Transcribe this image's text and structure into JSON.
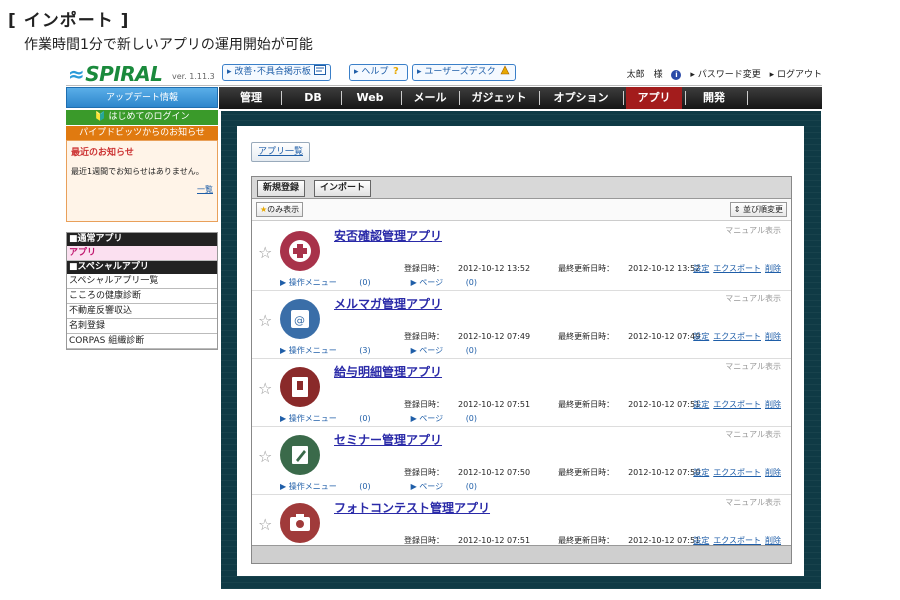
{
  "caption": {
    "title": "[ インポート ]",
    "subtitle": "作業時間1分で新しいアプリの運用開始が可能"
  },
  "header": {
    "logo": "SPIRAL",
    "version": "ver. 1.11.3",
    "buttons": [
      {
        "label": "▸ 改善･不具合掲示板",
        "icon": "board-icon"
      },
      {
        "label": "▸ ヘルプ",
        "icon": "help-icon"
      },
      {
        "label": "▸ ユーザーズデスク",
        "icon": "desk-icon"
      }
    ],
    "user": "太郎　様",
    "info_icon": "i",
    "password_change": "▸ パスワード変更",
    "logout": "▸ ログアウト"
  },
  "sidebar": {
    "update": "アップデート情報",
    "first_login": "はじめてのログイン",
    "pipe_notice": "パイプドビッツからのお知らせ",
    "news_title": "最近のお知らせ",
    "news_body": "最近1週間でお知らせはありません。",
    "news_more": "一覧",
    "sections": [
      {
        "header": "■通常アプリ",
        "items": [
          "アプリ"
        ]
      },
      {
        "header": "■スペシャルアプリ",
        "items": [
          "スペシャルアプリ一覧",
          "こころの健康診断",
          "不動産反響収込",
          "名刺登録",
          "CORPAS 組織診断"
        ]
      }
    ]
  },
  "nav": {
    "items": [
      "管理",
      "DB",
      "Web",
      "メール",
      "ガジェット",
      "オプション",
      "アプリ",
      "開発"
    ],
    "active": "アプリ"
  },
  "main": {
    "app_list_button": "アプリ一覧",
    "tabs": [
      "新規登録",
      "インポート"
    ],
    "filter_label": "のみ表示",
    "sort_label": "並び順変更",
    "manual_label": "マニュアル表示",
    "submenu_ops": "▶ 操作メニュー",
    "submenu_pages": "▶ ページ",
    "actions": [
      "設定",
      "エクスポート",
      "削除"
    ],
    "created_label": "登録日時：",
    "updated_label": "最終更新日時：",
    "apps": [
      {
        "name": "安否確認管理アプリ",
        "created": "2012-10-12 13:52",
        "updated": "2012-10-12 13:52",
        "ops": "(0)",
        "pages": "(0)",
        "color": "#a8324a",
        "icon": "plus-icon"
      },
      {
        "name": "メルマガ管理アプリ",
        "created": "2012-10-12 07:49",
        "updated": "2012-10-12 07:49",
        "ops": "(3)",
        "pages": "(0)",
        "color": "#3a6ea8",
        "icon": "mail-icon"
      },
      {
        "name": "給与明細管理アプリ",
        "created": "2012-10-12 07:51",
        "updated": "2012-10-12 07:51",
        "ops": "(0)",
        "pages": "(0)",
        "color": "#8a2a2a",
        "icon": "book-icon"
      },
      {
        "name": "セミナー管理アプリ",
        "created": "2012-10-12 07:50",
        "updated": "2012-10-12 07:50",
        "ops": "(0)",
        "pages": "(0)",
        "color": "#3a6a4a",
        "icon": "pen-icon"
      },
      {
        "name": "フォトコンテスト管理アプリ",
        "created": "2012-10-12 07:51",
        "updated": "2012-10-12 07:51",
        "ops": "(0)",
        "pages": "(0)",
        "color": "#a03a3a",
        "icon": "camera-icon"
      }
    ]
  }
}
